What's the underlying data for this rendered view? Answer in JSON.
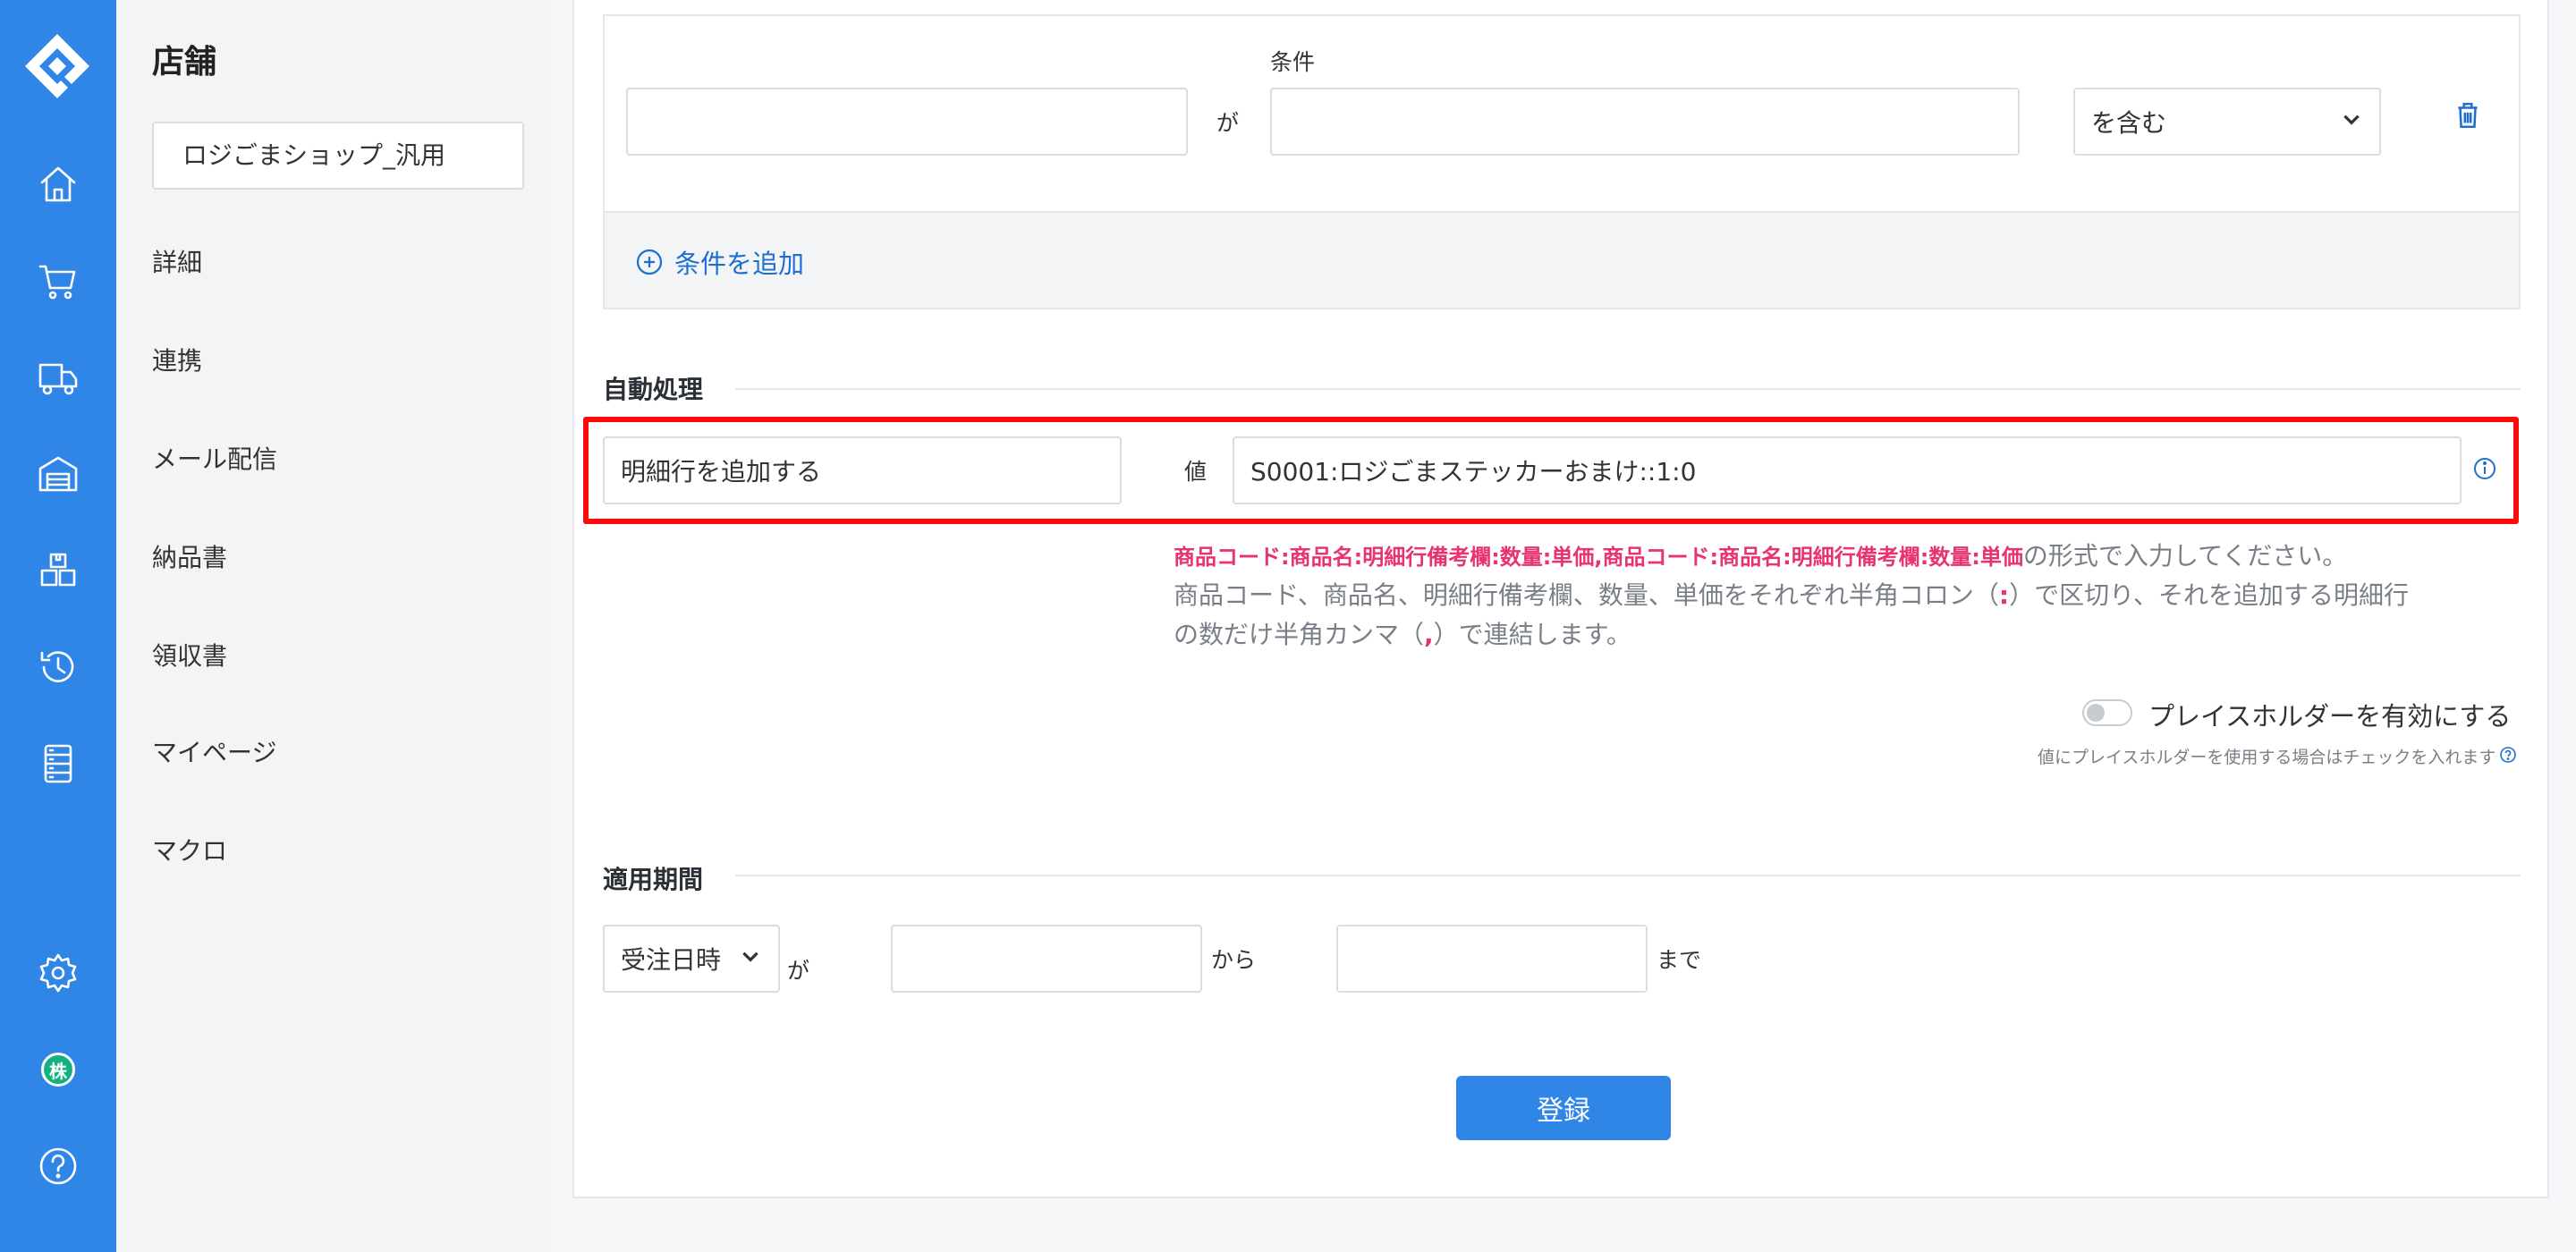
{
  "sidebar": {
    "icons": [
      "logo-icon",
      "home-icon",
      "cart-icon",
      "truck-icon",
      "warehouse-icon",
      "boxes-icon",
      "history-icon",
      "list-icon",
      "gear-icon",
      "kabu-icon",
      "help-icon"
    ],
    "kabu_label": "株",
    "help_label": "?"
  },
  "subnav": {
    "title": "店舗",
    "shop": "ロジごまショップ_汎用",
    "items": [
      "詳細",
      "連携",
      "メール配信",
      "納品書",
      "領収書",
      "マイページ",
      "マクロ"
    ]
  },
  "conditions": {
    "field_value": "",
    "ga": "が",
    "condition_label": "条件",
    "condition_value": "",
    "operator": "を含む",
    "add_condition": "条件を追加"
  },
  "auto_process": {
    "title": "自動処理",
    "action": "明細行を追加する",
    "value_label": "値",
    "value": "S0001:ロジごまステッカーおまけ::1:0",
    "help_format": "商品コード:商品名:明細行備考欄:数量:単価,商品コード:商品名:明細行備考欄:数量:単価",
    "help_format_suffix": "の形式で入力してください。",
    "help_line2_a": "商品コード、商品名、明細行備考欄、数量、単価をそれぞれ半角コロン（",
    "help_colon": ":",
    "help_line2_b": "）で区切り、それを追加する明細行",
    "help_line3_a": "の数だけ半角カンマ（",
    "help_comma": ",",
    "help_line3_b": "）で連結します。",
    "placeholder_toggle_label": "プレイスホルダーを有効にする",
    "placeholder_toggle_on": false,
    "placeholder_note": "値にプレイスホルダーを使用する場合はチェックを入れます"
  },
  "period": {
    "title": "適用期間",
    "basis": "受注日時",
    "ga": "が",
    "from_value": "",
    "kara": "から",
    "to_value": "",
    "made": "まで"
  },
  "submit_label": "登録",
  "colors": {
    "primary": "#2f86e6",
    "highlight": "#ff0a0a",
    "pink": "#e8336d",
    "link": "#1f6fcf"
  }
}
